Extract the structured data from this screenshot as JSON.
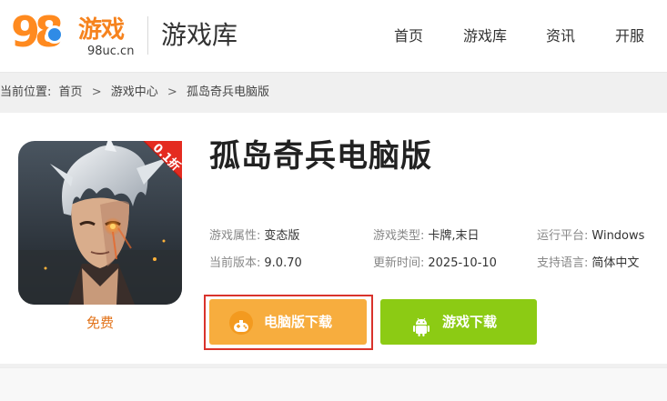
{
  "header": {
    "logo_number": "98",
    "logo_text": "游戏",
    "logo_domain": "98uc.cn",
    "section_title": "游戏库",
    "nav": [
      "首页",
      "游戏库",
      "资讯",
      "开服"
    ]
  },
  "breadcrumb": {
    "label": "当前位置:",
    "items": [
      "首页",
      "游戏中心",
      "孤岛奇兵电脑版"
    ],
    "separator": ">"
  },
  "game": {
    "title": "孤岛奇兵电脑版",
    "badge_text": "0.1折",
    "price": "免费",
    "attributes": [
      {
        "key": "游戏属性:",
        "value": "变态版"
      },
      {
        "key": "游戏类型:",
        "value": "卡牌,末日"
      },
      {
        "key": "运行平台:",
        "value": "Windows"
      },
      {
        "key": "当前版本:",
        "value": "9.0.70"
      },
      {
        "key": "更新时间:",
        "value": "2025-10-10"
      },
      {
        "key": "支持语言:",
        "value": "简体中文"
      }
    ]
  },
  "buttons": {
    "pc_download": "电脑版下载",
    "game_download": "游戏下载"
  },
  "colors": {
    "brand_orange": "#f6831e",
    "pc_button": "#f7ad3e",
    "game_button": "#8ccb14",
    "highlight_frame": "#d9332c",
    "price_text": "#e2731a"
  },
  "icons": [
    "gamepad-icon",
    "android-icon"
  ]
}
